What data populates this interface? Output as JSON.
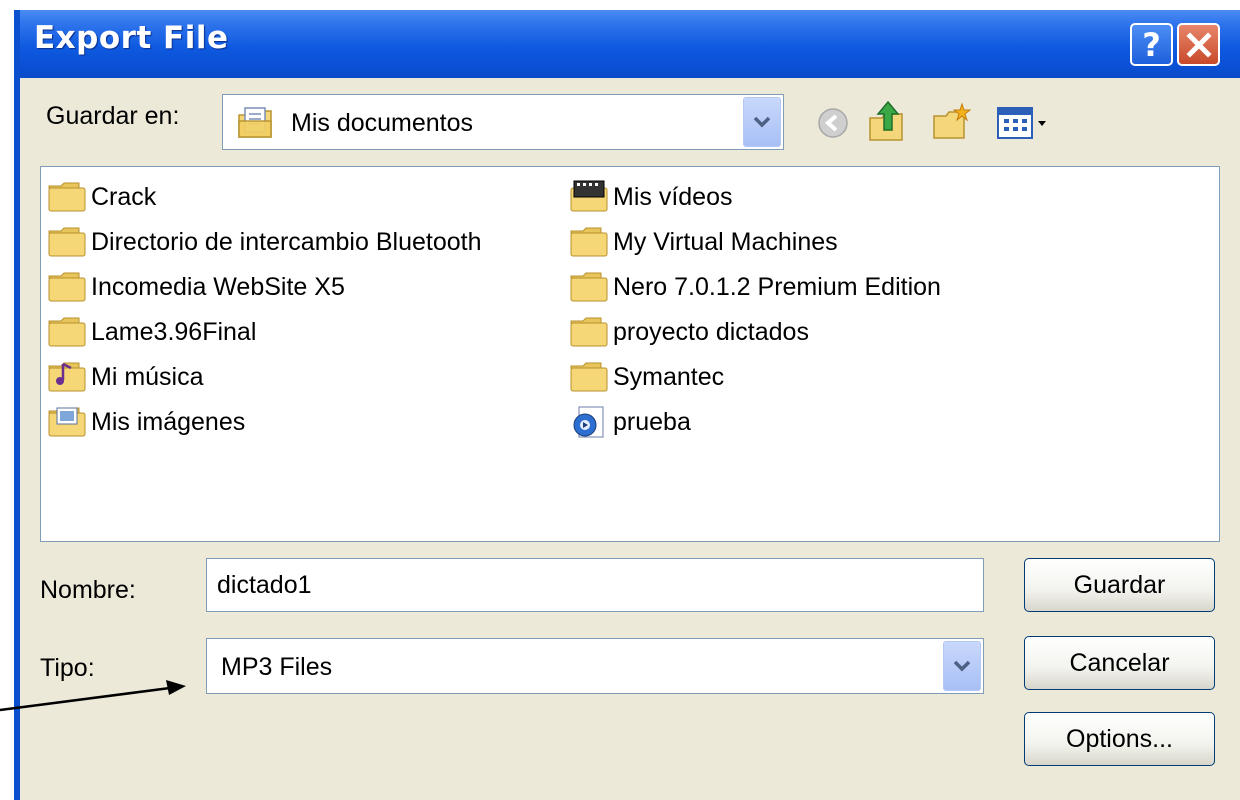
{
  "window": {
    "title": "Export File"
  },
  "titlebar_buttons": {
    "help": "?",
    "close_icon": "close-icon"
  },
  "location": {
    "label": "Guardar en:",
    "selected": "Mis documentos",
    "icon": "my-documents-icon"
  },
  "toolbar": {
    "icons": [
      "back-icon",
      "up-folder-icon",
      "new-folder-icon",
      "view-menu-icon"
    ]
  },
  "files": {
    "column1": [
      {
        "name": "Crack",
        "icon": "folder-icon"
      },
      {
        "name": "Directorio de intercambio Bluetooth",
        "icon": "folder-icon"
      },
      {
        "name": "Incomedia WebSite X5",
        "icon": "folder-icon"
      },
      {
        "name": "Lame3.96Final",
        "icon": "folder-icon"
      },
      {
        "name": "Mi música",
        "icon": "music-folder-icon"
      },
      {
        "name": "Mis imágenes",
        "icon": "pictures-folder-icon"
      }
    ],
    "column2": [
      {
        "name": "Mis vídeos",
        "icon": "video-folder-icon"
      },
      {
        "name": "My Virtual Machines",
        "icon": "folder-icon"
      },
      {
        "name": "Nero 7.0.1.2 Premium Edition",
        "icon": "folder-icon"
      },
      {
        "name": "proyecto dictados",
        "icon": "folder-icon"
      },
      {
        "name": "Symantec",
        "icon": "folder-icon"
      },
      {
        "name": "prueba",
        "icon": "media-file-icon"
      }
    ]
  },
  "filename": {
    "label": "Nombre:",
    "value": "dictado1"
  },
  "filetype": {
    "label": "Tipo:",
    "selected": "MP3 Files"
  },
  "buttons": {
    "save": "Guardar",
    "cancel": "Cancelar",
    "options": "Options..."
  },
  "colors": {
    "titlebar": "#0b50d6",
    "dialog_bg": "#ece9d8",
    "close_button": "#c84a2a"
  }
}
